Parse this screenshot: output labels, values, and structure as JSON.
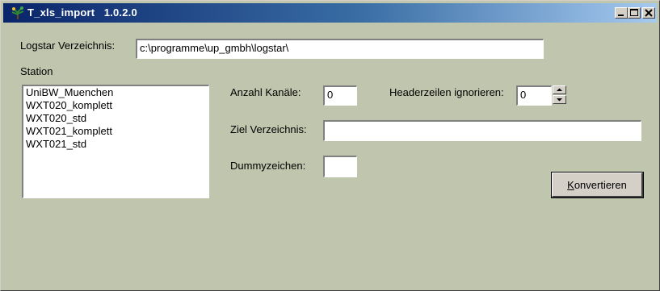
{
  "window": {
    "title": "T_xls_import   1.0.2.0",
    "controls": [
      "minimize",
      "maximize",
      "close"
    ]
  },
  "logstar": {
    "label": "Logstar Verzeichnis:",
    "value": "c:\\programme\\up_gmbh\\logstar\\"
  },
  "station": {
    "label": "Station",
    "items": [
      "UniBW_Muenchen",
      "WXT020_komplett",
      "WXT020_std",
      "WXT021_komplett",
      "WXT021_std"
    ]
  },
  "kanaele": {
    "label": "Anzahl Kanäle:",
    "value": "0"
  },
  "header": {
    "label": "Headerzeilen ignorieren:",
    "value": "0"
  },
  "ziel": {
    "label": "Ziel Verzeichnis:",
    "value": ""
  },
  "dummy": {
    "label": "Dummyzeichen:",
    "value": ""
  },
  "convert": {
    "accel": "K",
    "rest": "onvertieren"
  },
  "icons": {
    "app": "tree-app-icon",
    "minimize": "minimize-icon",
    "maximize": "maximize-icon",
    "close": "close-icon"
  },
  "colors": {
    "titlebar_start": "#0a246a",
    "titlebar_end": "#a6caf0",
    "window_bg": "#c0c5ad",
    "field_bg": "#ffffff"
  }
}
